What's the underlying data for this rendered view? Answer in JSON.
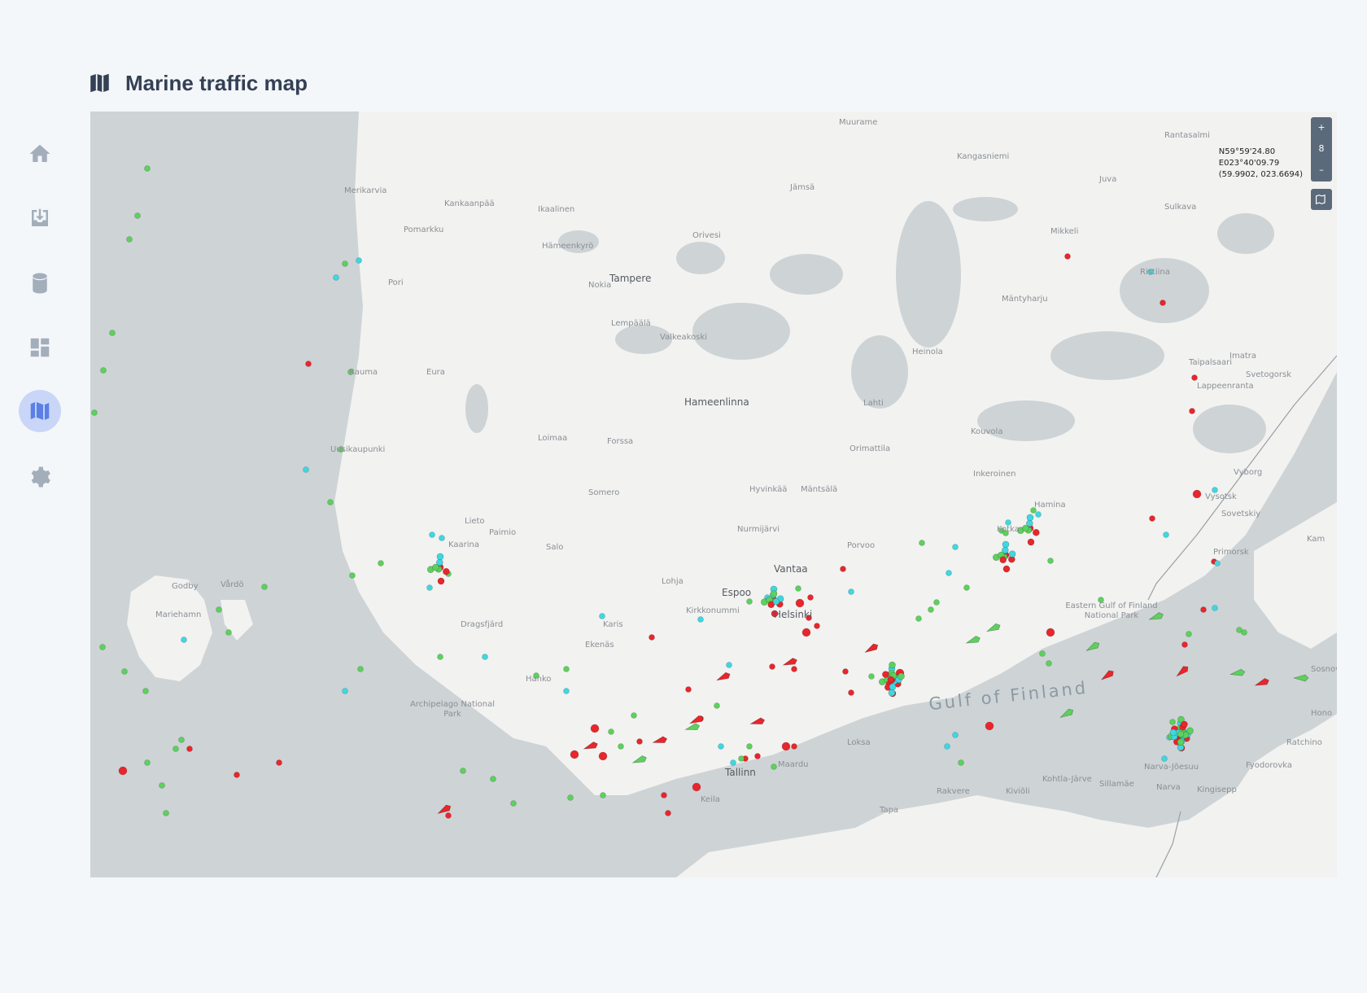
{
  "page": {
    "title": "Marine traffic map",
    "title_icon": "map-icon"
  },
  "sidebar": {
    "items": [
      {
        "name": "home",
        "icon": "home-icon",
        "active": false
      },
      {
        "name": "import",
        "icon": "inbox-download-icon",
        "active": false
      },
      {
        "name": "database",
        "icon": "database-icon",
        "active": false
      },
      {
        "name": "dashboard",
        "icon": "dashboard-icon",
        "active": false
      },
      {
        "name": "map",
        "icon": "map-icon",
        "active": true
      },
      {
        "name": "settings",
        "icon": "gear-icon",
        "active": false
      }
    ]
  },
  "map": {
    "zoom_in": "+",
    "zoom_level": "8",
    "zoom_out": "–",
    "layer_button_icon": "map-layers-icon",
    "coordinates": {
      "lat": "N59°59'24.80",
      "lon": "E023°40'09.79",
      "decimal": "(59.9902, 023.6694)"
    },
    "sea_label": "Gulf of Finland",
    "places": [
      {
        "name": "Muurame"
      },
      {
        "name": "Rantasalmi"
      },
      {
        "name": "Kangasniemi"
      },
      {
        "name": "Juva"
      },
      {
        "name": "Jämsä"
      },
      {
        "name": "Merikarvia"
      },
      {
        "name": "Kankaanpää"
      },
      {
        "name": "Ikaalinen"
      },
      {
        "name": "Sulkava"
      },
      {
        "name": "Pomarkku"
      },
      {
        "name": "Orivesi"
      },
      {
        "name": "Mikkeli"
      },
      {
        "name": "Hämeenkyrö"
      },
      {
        "name": "Pori"
      },
      {
        "name": "Tampere",
        "big": true
      },
      {
        "name": "Nokia"
      },
      {
        "name": "Ristiina"
      },
      {
        "name": "Mäntyharju"
      },
      {
        "name": "Lempäälä"
      },
      {
        "name": "Valkeakoski"
      },
      {
        "name": "Heinola"
      },
      {
        "name": "Imatra"
      },
      {
        "name": "Taipalsaari"
      },
      {
        "name": "Rauma"
      },
      {
        "name": "Eura"
      },
      {
        "name": "Hameenlinna",
        "big": true
      },
      {
        "name": "Svetogorsk"
      },
      {
        "name": "Lahti"
      },
      {
        "name": "Lappeenranta"
      },
      {
        "name": "Kouvola"
      },
      {
        "name": "Loimaa"
      },
      {
        "name": "Forssa"
      },
      {
        "name": "Orimattila"
      },
      {
        "name": "Uusikaupunki"
      },
      {
        "name": "Inkeroinen"
      },
      {
        "name": "Vyborg"
      },
      {
        "name": "Hyvinkää"
      },
      {
        "name": "Mäntsälä"
      },
      {
        "name": "Somero"
      },
      {
        "name": "Hamina"
      },
      {
        "name": "Vysotsk"
      },
      {
        "name": "Lieto"
      },
      {
        "name": "Paimio"
      },
      {
        "name": "Sovetskiy"
      },
      {
        "name": "Nurmijärvi"
      },
      {
        "name": "Kotka"
      },
      {
        "name": "Kaarina"
      },
      {
        "name": "Porvoo"
      },
      {
        "name": "Salo"
      },
      {
        "name": "Primorsk"
      },
      {
        "name": "Vantaa",
        "big": true
      },
      {
        "name": "Godby"
      },
      {
        "name": "Vårdö"
      },
      {
        "name": "Lohja"
      },
      {
        "name": "Espoo",
        "big": true
      },
      {
        "name": "Kirkkonummi"
      },
      {
        "name": "Helsinki",
        "big": true
      },
      {
        "name": "Mariehamn"
      },
      {
        "name": "Dragsfjärd"
      },
      {
        "name": "Karis"
      },
      {
        "name": "Ekenäs"
      },
      {
        "name": "Hanko"
      },
      {
        "name": "Loksa"
      },
      {
        "name": "Hono"
      },
      {
        "name": "Ratchino"
      },
      {
        "name": "Sosnovy"
      },
      {
        "name": "Narva-Jõesuu"
      },
      {
        "name": "Fyodorovka"
      },
      {
        "name": "Kohtla-Järve"
      },
      {
        "name": "Sillamäe"
      },
      {
        "name": "Rakvere"
      },
      {
        "name": "Kiviõli"
      },
      {
        "name": "Narva"
      },
      {
        "name": "Kingisepp"
      },
      {
        "name": "Tallinn",
        "big": true
      },
      {
        "name": "Maardu"
      },
      {
        "name": "Keila"
      },
      {
        "name": "Tapa"
      },
      {
        "name": "Kam"
      }
    ],
    "parks": [
      {
        "name": "Archipelago National Park"
      },
      {
        "name": "Eastern Gulf of Finland National Park"
      }
    ],
    "legend_colors": {
      "green": "#5cd15c",
      "cyan": "#3fd7e0",
      "red": "#e8262b"
    }
  }
}
